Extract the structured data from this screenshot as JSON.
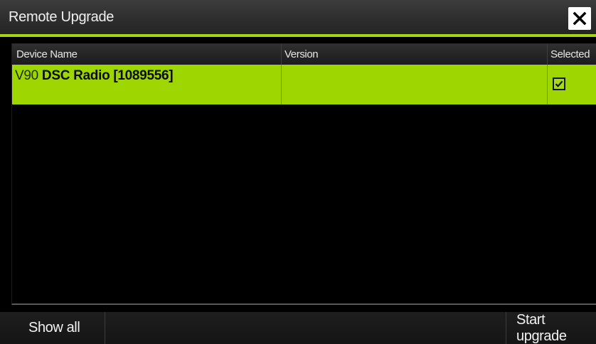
{
  "dialog": {
    "title": "Remote Upgrade",
    "accent_color": "#a4d414"
  },
  "table": {
    "columns": [
      "Device Name",
      "Version",
      "Selected"
    ],
    "rows": [
      {
        "device_prefix": "V90",
        "device_name": " DSC Radio [1089556]",
        "version": "",
        "selected": true
      }
    ],
    "selected_row_color": "#9dd600"
  },
  "footer": {
    "show_all_label": "Show all",
    "start_upgrade_label": "Start upgrade"
  },
  "icons": {
    "close": "close-icon",
    "checkbox": "checkmark-icon"
  }
}
